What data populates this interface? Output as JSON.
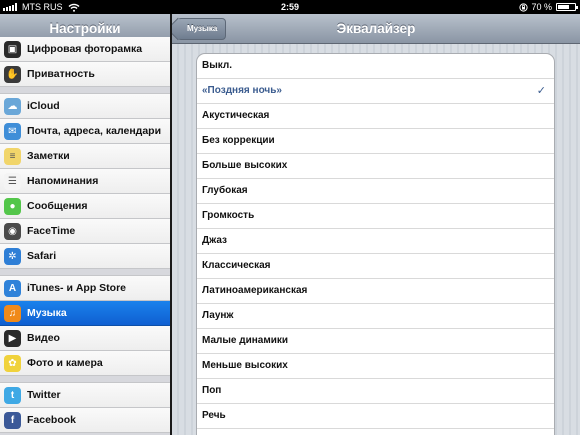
{
  "status": {
    "carrier": "MTS RUS",
    "time": "2:59",
    "battery": "70 %",
    "battery_level": 0.7
  },
  "master": {
    "title": "Настройки",
    "groups": [
      [
        {
          "label": "Цифровая фоторамка",
          "icon": "photo-frame-icon",
          "color": "#2a2a2a",
          "glyph": "▣"
        },
        {
          "label": "Приватность",
          "icon": "hand-icon",
          "color": "#3a3a3a",
          "glyph": "✋"
        }
      ],
      [
        {
          "label": "iCloud",
          "icon": "cloud-icon",
          "color": "#6aa7d8",
          "glyph": "☁"
        },
        {
          "label": "Почта, адреса, календари",
          "icon": "mail-icon",
          "color": "#3f8ed8",
          "glyph": "✉"
        },
        {
          "label": "Заметки",
          "icon": "notes-icon",
          "color": "#f1d56a",
          "glyph": "≡"
        },
        {
          "label": "Напоминания",
          "icon": "reminders-icon",
          "color": "#f4f4f4",
          "glyph": "☰"
        },
        {
          "label": "Сообщения",
          "icon": "messages-icon",
          "color": "#53c64a",
          "glyph": "●"
        },
        {
          "label": "FaceTime",
          "icon": "facetime-icon",
          "color": "#4b4b4b",
          "glyph": "◉"
        },
        {
          "label": "Safari",
          "icon": "safari-icon",
          "color": "#2f7fd6",
          "glyph": "✲"
        }
      ],
      [
        {
          "label": "iTunes- и App Store",
          "icon": "app-store-icon",
          "color": "#2f82d9",
          "glyph": "A"
        },
        {
          "label": "Музыка",
          "icon": "music-icon",
          "color": "#f08a1a",
          "glyph": "♫",
          "selected": true
        },
        {
          "label": "Видео",
          "icon": "video-icon",
          "color": "#2b2b2b",
          "glyph": "▶"
        },
        {
          "label": "Фото и камера",
          "icon": "photos-icon",
          "color": "#f0d23c",
          "glyph": "✿"
        }
      ],
      [
        {
          "label": "Twitter",
          "icon": "twitter-icon",
          "color": "#3fa9e5",
          "glyph": "t"
        },
        {
          "label": "Facebook",
          "icon": "facebook-icon",
          "color": "#3b5998",
          "glyph": "f"
        }
      ]
    ]
  },
  "detail": {
    "title": "Эквалайзер",
    "back_label": "Музыка",
    "items": [
      {
        "label": "Выкл."
      },
      {
        "label": "«Поздняя ночь»",
        "checked": true
      },
      {
        "label": "Акустическая"
      },
      {
        "label": "Без коррекции"
      },
      {
        "label": "Больше высоких"
      },
      {
        "label": "Глубокая"
      },
      {
        "label": "Громкость"
      },
      {
        "label": "Джаз"
      },
      {
        "label": "Классическая"
      },
      {
        "label": "Латиноамериканская"
      },
      {
        "label": "Лаунж"
      },
      {
        "label": "Малые динамики"
      },
      {
        "label": "Меньше высоких"
      },
      {
        "label": "Поп"
      },
      {
        "label": "Речь"
      },
      {
        "label": ""
      }
    ],
    "check_glyph": "✓"
  }
}
